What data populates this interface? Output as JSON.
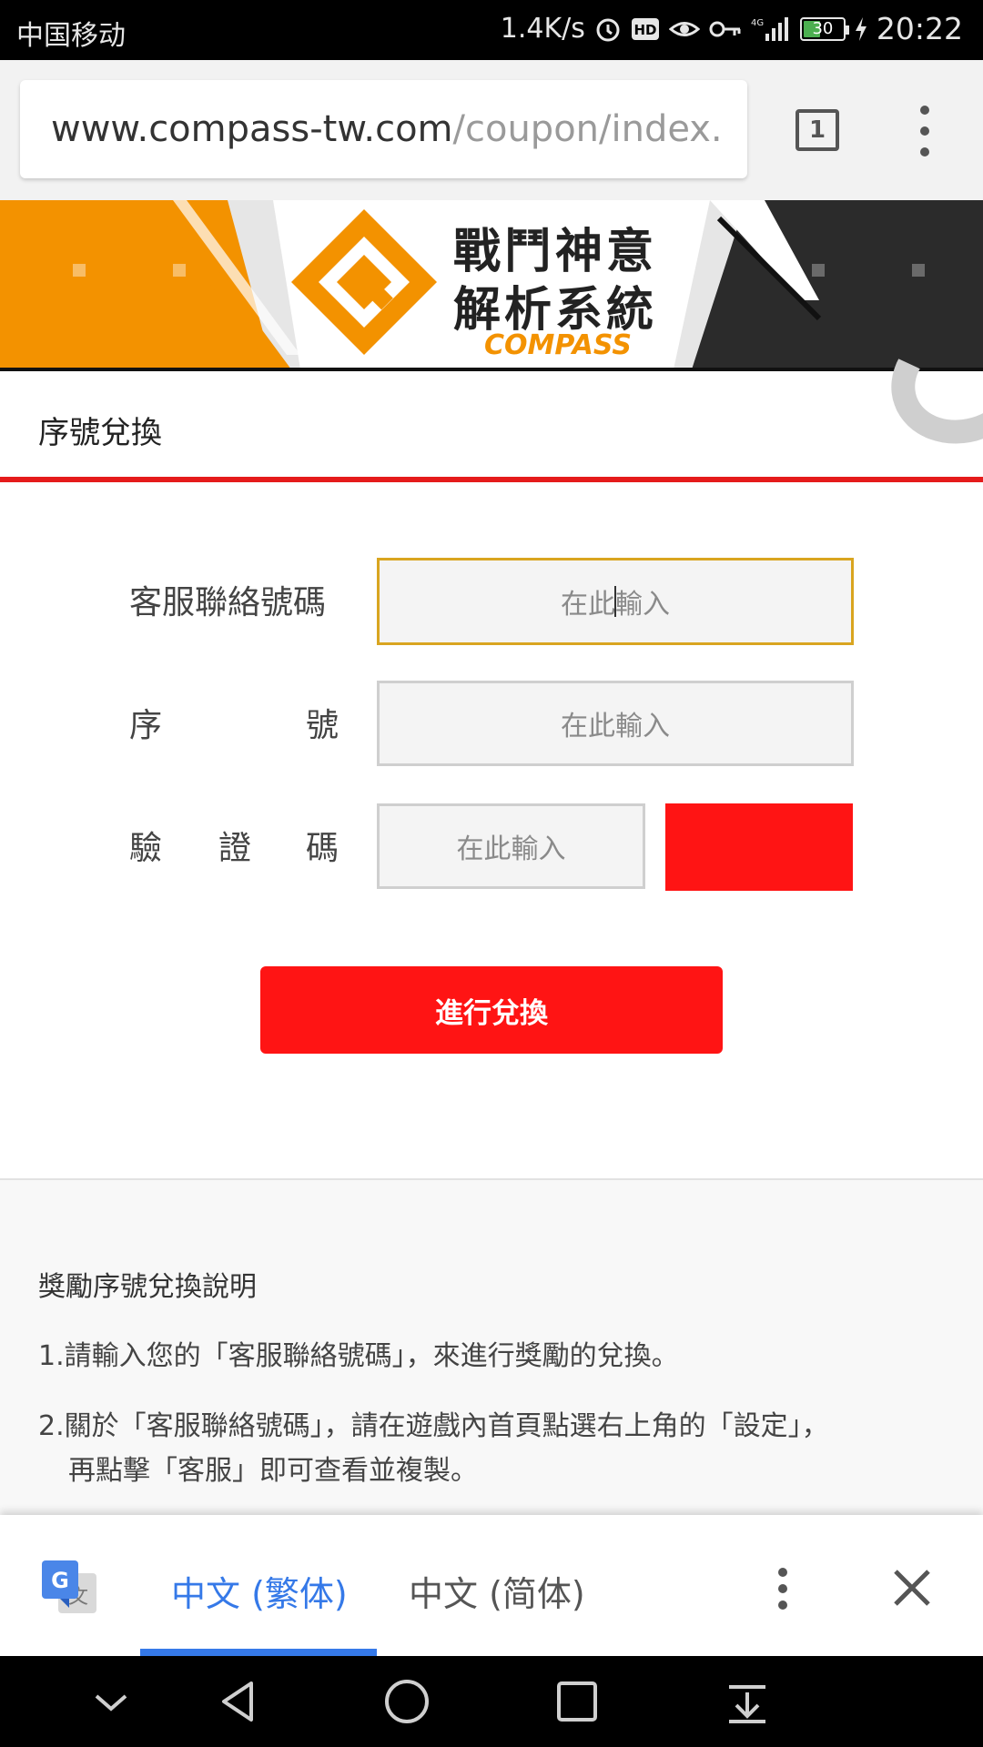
{
  "status_bar": {
    "carrier": "中国移动",
    "speed": "1.4K/s",
    "battery": "30",
    "time": "20:22",
    "icons": [
      "alarm-icon",
      "hd-icon",
      "eye-icon",
      "key-icon",
      "signal-4g-icon",
      "battery-icon",
      "charging-icon"
    ]
  },
  "browser": {
    "url_domain": "www.compass-tw.com",
    "url_path": "/coupon/index.",
    "tab_count": "1"
  },
  "banner": {
    "line1": "戰鬥神意",
    "line2": "解析系統",
    "brand": "COMPASS"
  },
  "page": {
    "title": "序號兌換"
  },
  "form": {
    "contact_label": "客服聯絡號碼",
    "serial_label_a": "序",
    "serial_label_b": "號",
    "captcha_label_a": "驗",
    "captcha_label_b": "證",
    "captcha_label_c": "碼",
    "contact_placeholder_a": "在此",
    "contact_placeholder_b": "輸入",
    "serial_placeholder": "在此輸入",
    "captcha_placeholder": "在此輸入",
    "submit_label": "進行兌換"
  },
  "instructions": {
    "title": "獎勵序號兌換說明",
    "item1": "1.請輸入您的「客服聯絡號碼」，來進行獎勵的兌換。",
    "item2_line1": "2.關於「客服聯絡號碼」，請在遊戲內首頁點選右上角的「設定」，",
    "item2_line2": "再點擊「客服」即可查看並複製。"
  },
  "translate_bar": {
    "tab_traditional": "中文 (繁体)",
    "tab_simplified": "中文 (简体)"
  },
  "colors": {
    "accent_red": "#ff1414",
    "title_underline": "#e51b1b",
    "focus_border": "#d9a520",
    "translate_blue": "#3579e8",
    "banner_orange": "#f39200"
  }
}
